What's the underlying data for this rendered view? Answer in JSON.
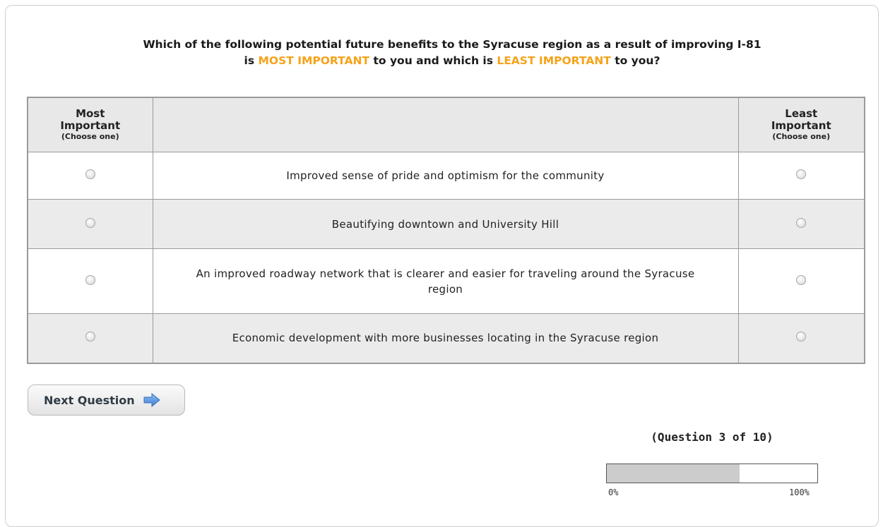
{
  "question": {
    "line1": "Which of the following potential future benefits to the Syracuse region as a result of improving I-81",
    "line2_prefix": "is ",
    "most_label": "MOST IMPORTANT",
    "line2_middle": " to you and which is ",
    "least_label": "LEAST IMPORTANT",
    "line2_suffix": " to you?",
    "highlight_color": "#f5a31a"
  },
  "table": {
    "most_header": "Most Important",
    "least_header": "Least Important",
    "choose_note": "(Choose one)",
    "rows": [
      {
        "label": "Improved sense of pride and optimism for the community"
      },
      {
        "label": "Beautifying downtown and University Hill"
      },
      {
        "label": "An improved roadway network that is clearer and easier for traveling around the Syracuse region"
      },
      {
        "label": "Economic development with more businesses locating in the Syracuse region"
      }
    ]
  },
  "next_button": {
    "label": "Next Question",
    "icon": "right-arrow-icon"
  },
  "progress": {
    "label": "(Question 3 of 10)",
    "fraction": 0.63,
    "min_label": "0%",
    "max_label": "100%"
  }
}
